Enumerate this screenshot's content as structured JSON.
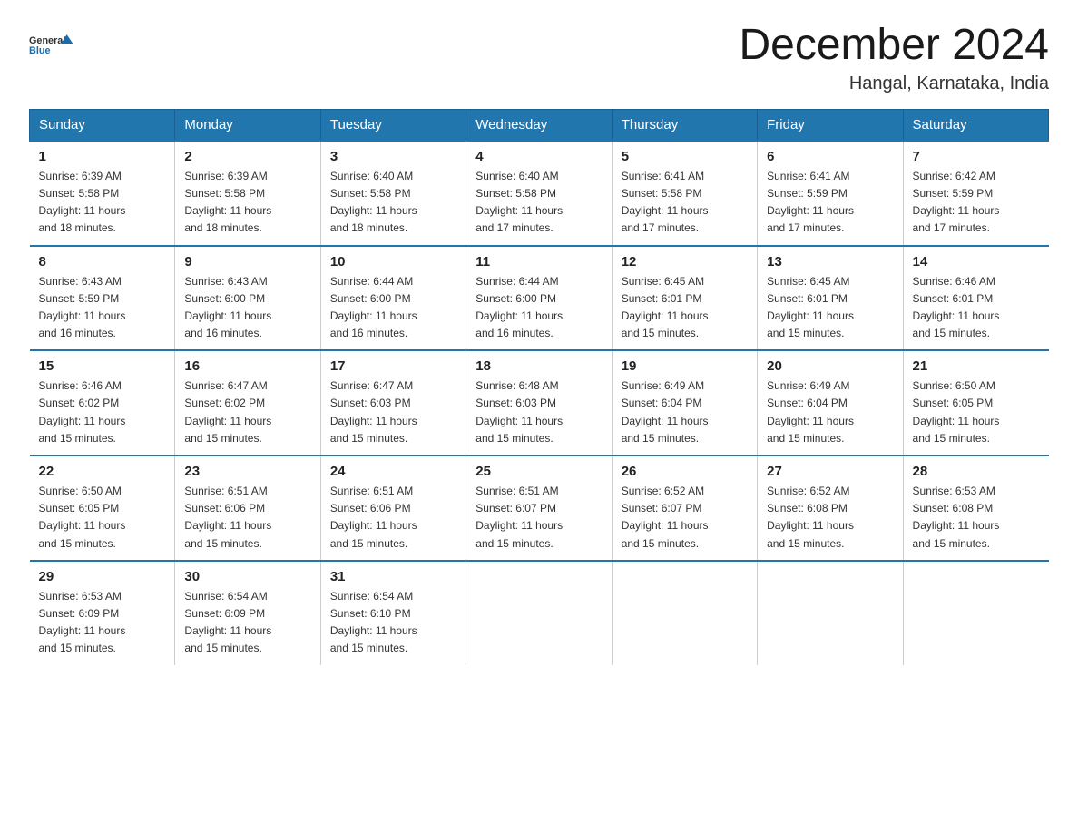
{
  "logo": {
    "text_general": "General",
    "text_blue": "Blue",
    "tagline": "GeneralBlue"
  },
  "header": {
    "month": "December 2024",
    "location": "Hangal, Karnataka, India"
  },
  "weekdays": [
    "Sunday",
    "Monday",
    "Tuesday",
    "Wednesday",
    "Thursday",
    "Friday",
    "Saturday"
  ],
  "weeks": [
    [
      {
        "day": "1",
        "sunrise": "6:39 AM",
        "sunset": "5:58 PM",
        "daylight": "11 hours and 18 minutes."
      },
      {
        "day": "2",
        "sunrise": "6:39 AM",
        "sunset": "5:58 PM",
        "daylight": "11 hours and 18 minutes."
      },
      {
        "day": "3",
        "sunrise": "6:40 AM",
        "sunset": "5:58 PM",
        "daylight": "11 hours and 18 minutes."
      },
      {
        "day": "4",
        "sunrise": "6:40 AM",
        "sunset": "5:58 PM",
        "daylight": "11 hours and 17 minutes."
      },
      {
        "day": "5",
        "sunrise": "6:41 AM",
        "sunset": "5:58 PM",
        "daylight": "11 hours and 17 minutes."
      },
      {
        "day": "6",
        "sunrise": "6:41 AM",
        "sunset": "5:59 PM",
        "daylight": "11 hours and 17 minutes."
      },
      {
        "day": "7",
        "sunrise": "6:42 AM",
        "sunset": "5:59 PM",
        "daylight": "11 hours and 17 minutes."
      }
    ],
    [
      {
        "day": "8",
        "sunrise": "6:43 AM",
        "sunset": "5:59 PM",
        "daylight": "11 hours and 16 minutes."
      },
      {
        "day": "9",
        "sunrise": "6:43 AM",
        "sunset": "6:00 PM",
        "daylight": "11 hours and 16 minutes."
      },
      {
        "day": "10",
        "sunrise": "6:44 AM",
        "sunset": "6:00 PM",
        "daylight": "11 hours and 16 minutes."
      },
      {
        "day": "11",
        "sunrise": "6:44 AM",
        "sunset": "6:00 PM",
        "daylight": "11 hours and 16 minutes."
      },
      {
        "day": "12",
        "sunrise": "6:45 AM",
        "sunset": "6:01 PM",
        "daylight": "11 hours and 15 minutes."
      },
      {
        "day": "13",
        "sunrise": "6:45 AM",
        "sunset": "6:01 PM",
        "daylight": "11 hours and 15 minutes."
      },
      {
        "day": "14",
        "sunrise": "6:46 AM",
        "sunset": "6:01 PM",
        "daylight": "11 hours and 15 minutes."
      }
    ],
    [
      {
        "day": "15",
        "sunrise": "6:46 AM",
        "sunset": "6:02 PM",
        "daylight": "11 hours and 15 minutes."
      },
      {
        "day": "16",
        "sunrise": "6:47 AM",
        "sunset": "6:02 PM",
        "daylight": "11 hours and 15 minutes."
      },
      {
        "day": "17",
        "sunrise": "6:47 AM",
        "sunset": "6:03 PM",
        "daylight": "11 hours and 15 minutes."
      },
      {
        "day": "18",
        "sunrise": "6:48 AM",
        "sunset": "6:03 PM",
        "daylight": "11 hours and 15 minutes."
      },
      {
        "day": "19",
        "sunrise": "6:49 AM",
        "sunset": "6:04 PM",
        "daylight": "11 hours and 15 minutes."
      },
      {
        "day": "20",
        "sunrise": "6:49 AM",
        "sunset": "6:04 PM",
        "daylight": "11 hours and 15 minutes."
      },
      {
        "day": "21",
        "sunrise": "6:50 AM",
        "sunset": "6:05 PM",
        "daylight": "11 hours and 15 minutes."
      }
    ],
    [
      {
        "day": "22",
        "sunrise": "6:50 AM",
        "sunset": "6:05 PM",
        "daylight": "11 hours and 15 minutes."
      },
      {
        "day": "23",
        "sunrise": "6:51 AM",
        "sunset": "6:06 PM",
        "daylight": "11 hours and 15 minutes."
      },
      {
        "day": "24",
        "sunrise": "6:51 AM",
        "sunset": "6:06 PM",
        "daylight": "11 hours and 15 minutes."
      },
      {
        "day": "25",
        "sunrise": "6:51 AM",
        "sunset": "6:07 PM",
        "daylight": "11 hours and 15 minutes."
      },
      {
        "day": "26",
        "sunrise": "6:52 AM",
        "sunset": "6:07 PM",
        "daylight": "11 hours and 15 minutes."
      },
      {
        "day": "27",
        "sunrise": "6:52 AM",
        "sunset": "6:08 PM",
        "daylight": "11 hours and 15 minutes."
      },
      {
        "day": "28",
        "sunrise": "6:53 AM",
        "sunset": "6:08 PM",
        "daylight": "11 hours and 15 minutes."
      }
    ],
    [
      {
        "day": "29",
        "sunrise": "6:53 AM",
        "sunset": "6:09 PM",
        "daylight": "11 hours and 15 minutes."
      },
      {
        "day": "30",
        "sunrise": "6:54 AM",
        "sunset": "6:09 PM",
        "daylight": "11 hours and 15 minutes."
      },
      {
        "day": "31",
        "sunrise": "6:54 AM",
        "sunset": "6:10 PM",
        "daylight": "11 hours and 15 minutes."
      },
      null,
      null,
      null,
      null
    ]
  ],
  "labels": {
    "sunrise": "Sunrise:",
    "sunset": "Sunset:",
    "daylight": "Daylight:"
  }
}
